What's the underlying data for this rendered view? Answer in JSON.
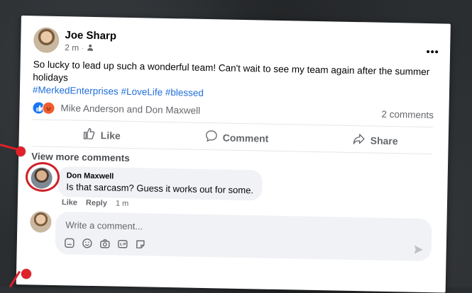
{
  "post": {
    "author": "Joe Sharp",
    "time": "2 m",
    "audience_icon": "friends-icon",
    "more_icon": "more-options-icon",
    "text": "So lucky to lead up such a wonderful team! Can't wait to see my team again after the summer holidays",
    "hashtags": "#MerkedEnterprises #LoveLife #blessed",
    "reactions_text": "Mike Anderson and Don Maxwell",
    "comments_count": "2 comments",
    "reaction_icons": [
      "like-icon",
      "angry-icon"
    ]
  },
  "actions": {
    "like": "Like",
    "comment": "Comment",
    "share": "Share"
  },
  "comments": {
    "view_more": "View more comments",
    "items": [
      {
        "author": "Don Maxwell",
        "text": "Is that sarcasm? Guess it works out for some.",
        "like_label": "Like",
        "reply_label": "Reply",
        "time": "1 m"
      }
    ]
  },
  "composer": {
    "placeholder": "Write a comment...",
    "tool_icons": [
      "sticker-icon",
      "emoji-icon",
      "camera-icon",
      "gif-icon",
      "sticker-alt-icon"
    ],
    "send_icon": "send-icon"
  },
  "colors": {
    "accent": "#216fdb",
    "annotation_red": "#e0202a",
    "background": "#2b2e31"
  }
}
